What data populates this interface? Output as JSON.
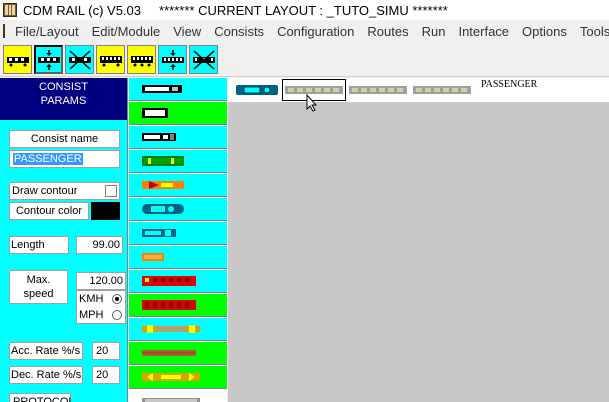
{
  "window": {
    "title": "CDM RAIL (c) V5.03     ******* CURRENT LAYOUT : _TUTO_SIMU *******"
  },
  "menu": {
    "items": [
      "File/Layout",
      "Edit/Module",
      "View",
      "Consists",
      "Configuration",
      "Routes",
      "Run",
      "Interface",
      "Options",
      "Tools"
    ]
  },
  "toolbar": {
    "buttons": [
      {
        "icon": "train-consist-icon",
        "color": "#ffff00"
      },
      {
        "icon": "train-couple-icon",
        "color": "#00ffff",
        "pressed": true
      },
      {
        "icon": "train-delete-icon",
        "color": "#00ffff"
      },
      {
        "icon": "wagon-icon",
        "color": "#ffff00"
      },
      {
        "icon": "wagon-add-icon",
        "color": "#ffff00"
      },
      {
        "icon": "wagon-couple-icon",
        "color": "#00ffff"
      },
      {
        "icon": "wagon-delete-icon",
        "color": "#00ffff"
      }
    ]
  },
  "consist_params": {
    "header_line1": "CONSIST",
    "header_line2": "PARAMS",
    "consist_name_label": "Consist name",
    "consist_name_value": "PASSENGER",
    "draw_contour_label": "Draw contour",
    "draw_contour_checked": false,
    "contour_color_label": "Contour color",
    "contour_color_value": "#000000",
    "length_label": "Length",
    "length_value": "99.00",
    "max_speed_label_line1": "Max.",
    "max_speed_label_line2": "speed",
    "max_speed_value": "120.00",
    "unit_kmh": "KMH",
    "unit_mph": "MPH",
    "selected_unit": "KMH",
    "acc_rate_label": "Acc. Rate %/s",
    "acc_rate_value": "20",
    "dec_rate_label": "Dec. Rate %/s",
    "dec_rate_value": "20",
    "protocol_label": "PROTOCOL"
  },
  "palette": {
    "rows": [
      {
        "bg": "#00ffff",
        "icon": "diesel-loco-icon"
      },
      {
        "bg": "#00ff00",
        "icon": "box-car-icon"
      },
      {
        "bg": "#00ffff",
        "icon": "switcher-loco-icon"
      },
      {
        "bg": "#00ff00",
        "icon": "green-loco-icon"
      },
      {
        "bg": "#00ffff",
        "icon": "orange-loco-icon"
      },
      {
        "bg": "#00ffff",
        "icon": "teal-railcar-icon"
      },
      {
        "bg": "#00ffff",
        "icon": "teal-loco-icon"
      },
      {
        "bg": "#00ffff",
        "icon": "orange-small-car-icon"
      },
      {
        "bg": "#00ffff",
        "icon": "red-coach-icon"
      },
      {
        "bg": "#00ff00",
        "icon": "red-coach-2-icon"
      },
      {
        "bg": "#00ffff",
        "icon": "yellow-coach-icon"
      },
      {
        "bg": "#00ff00",
        "icon": "flat-car-icon"
      },
      {
        "bg": "#00ff00",
        "icon": "yellow-loco-icon"
      },
      {
        "bg": "#ffffff",
        "icon": "grey-coach-icon"
      }
    ]
  },
  "consist_strip": {
    "label": "PASSENGER",
    "items": [
      "teal-loco-icon",
      "grey-coach-icon",
      "grey-coach-icon",
      "grey-coach-icon",
      "grey-coach-icon"
    ]
  },
  "colors": {
    "panel_bg": "#00ffff",
    "header_bg": "#000080",
    "canvas_bg": "#c8c8c8",
    "selection": "#3399ff"
  }
}
